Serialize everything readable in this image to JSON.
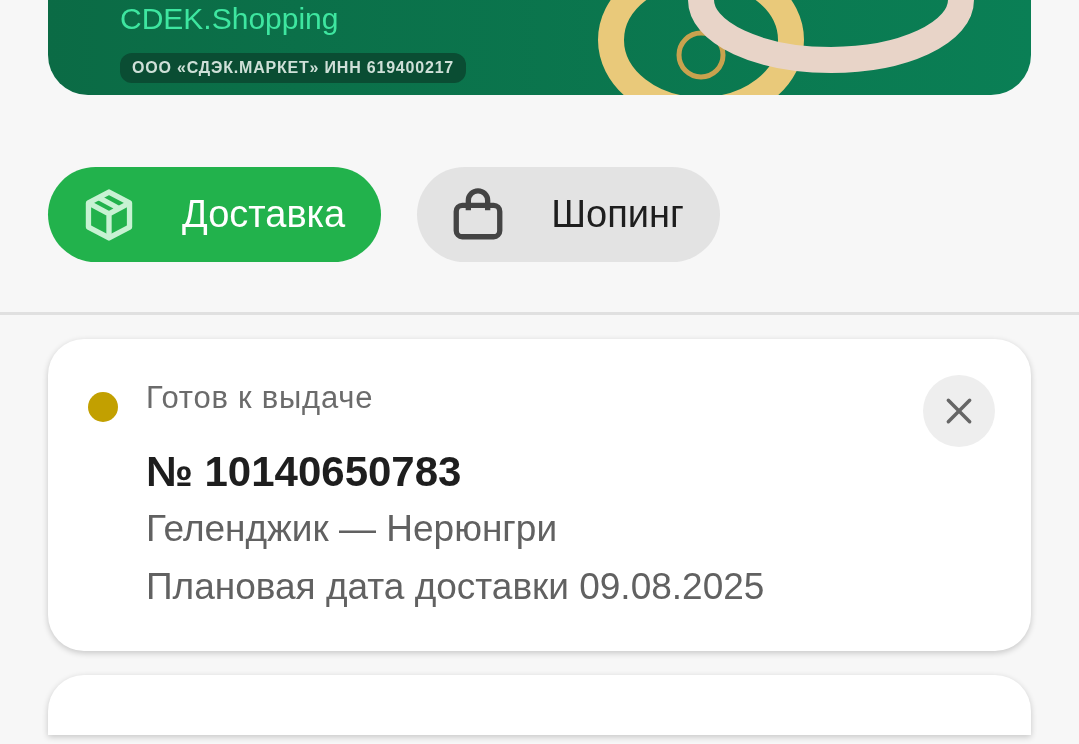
{
  "banner": {
    "title": "CDEK.Shopping",
    "legal_note": "ООО «СДЭК.МАРКЕТ» ИНН 619400217"
  },
  "tabs": [
    {
      "label": "Доставка",
      "kind": "delivery",
      "selected": true
    },
    {
      "label": "Шопинг",
      "kind": "shopping",
      "selected": false
    }
  ],
  "orders": [
    {
      "status": "Готов к выдаче",
      "color": "#c2a000",
      "number": "№ 10140650783",
      "route": "Геленджик — Нерюнгри",
      "planned_date": "Плановая дата доставки 09.08.2025"
    }
  ]
}
